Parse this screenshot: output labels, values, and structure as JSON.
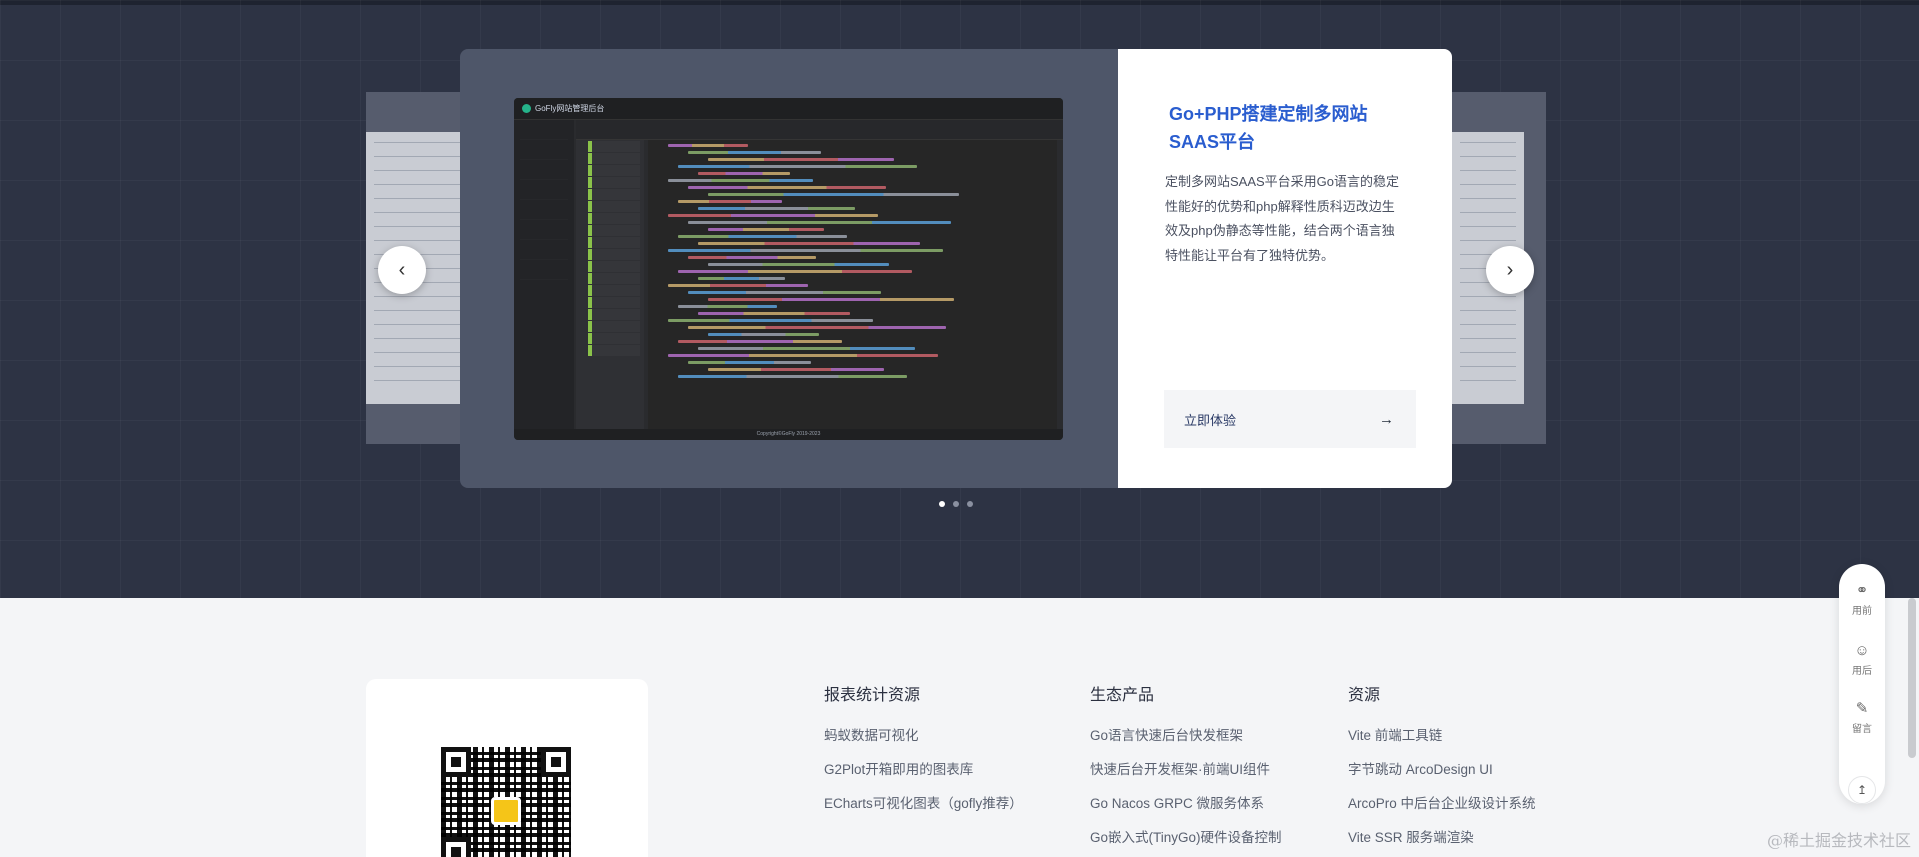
{
  "carousel": {
    "slide_title": "Go+PHP搭建定制多网站SAAS平台",
    "slide_description": "定制多网站SAAS平台采用Go语言的稳定性能好的优势和php解释性质科迈改边生效及php伪静态等性能，结合两个语言独特性能让平台有了独特优势。",
    "try_label": "立即体验",
    "try_icon": "arrow-right-icon",
    "prev_icon": "chevron-left-icon",
    "next_icon": "chevron-right-icon",
    "dots": 3,
    "active_dot": 0,
    "ide_app_title": "GoFly网站管理后台",
    "ide_footer": "Copyright©GoFly 2019-2023"
  },
  "footer": {
    "columns": [
      {
        "title": "报表统计资源",
        "links": [
          "蚂蚁数据可视化",
          "G2Plot开箱即用的图表库",
          "ECharts可视化图表（gofly推荐）"
        ]
      },
      {
        "title": "生态产品",
        "links": [
          "Go语言快速后台快发框架",
          "快速后台开发框架·前端UI组件",
          "Go Nacos GRPC 微服务体系",
          "Go嵌入式(TinyGo)硬件设备控制"
        ]
      },
      {
        "title": "资源",
        "links": [
          "Vite 前端工具链",
          "字节跳动 ArcoDesign UI",
          "ArcoPro 中后台企业级设计系统",
          "Vite SSR 服务端渲染"
        ]
      }
    ]
  },
  "float_toolbar": {
    "items": [
      {
        "label": "用前",
        "icon": "headset-icon"
      },
      {
        "label": "用后",
        "icon": "user-question-icon"
      },
      {
        "label": "留言",
        "icon": "pencil-icon"
      }
    ],
    "back_top_icon": "back-to-top-icon"
  },
  "watermark": "@稀土掘金技术社区",
  "colors": {
    "hero_bg": "#2d3344",
    "accent_blue": "#2a5dcf",
    "footer_bg": "#f4f5f7"
  }
}
